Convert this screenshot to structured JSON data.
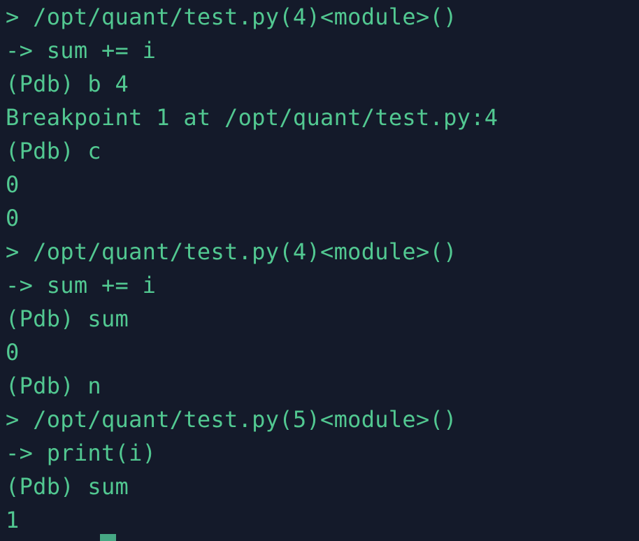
{
  "terminal": {
    "lines": [
      "> /opt/quant/test.py(4)<module>()",
      "-> sum += i",
      "(Pdb) b 4",
      "Breakpoint 1 at /opt/quant/test.py:4",
      "(Pdb) c",
      "0",
      "0",
      "> /opt/quant/test.py(4)<module>()",
      "-> sum += i",
      "(Pdb) sum",
      "0",
      "(Pdb) n",
      "> /opt/quant/test.py(5)<module>()",
      "-> print(i)",
      "(Pdb) sum",
      "1"
    ],
    "colors": {
      "background": "#141a2a",
      "text": "#52c891",
      "cursor": "#46a884"
    }
  }
}
